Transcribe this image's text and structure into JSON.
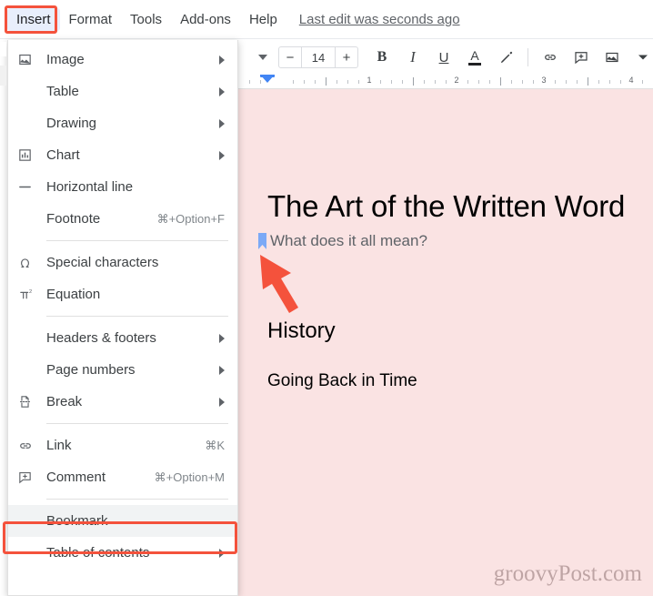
{
  "app": {
    "name": "Google Docs",
    "accent_blue": "#4285f4",
    "highlight_red": "#f4523c",
    "doc_background": "#fae3e3",
    "menu_hover": "#f1f3f4"
  },
  "menubar": {
    "items": [
      {
        "label": "Insert",
        "active": true
      },
      {
        "label": "Format",
        "active": false
      },
      {
        "label": "Tools",
        "active": false
      },
      {
        "label": "Add-ons",
        "active": false
      },
      {
        "label": "Help",
        "active": false
      }
    ],
    "last_edit": "Last edit was seconds ago"
  },
  "toolbar": {
    "font_dropdown_icon": "chevron-down-icon",
    "font_size_decrease": "−",
    "font_size_value": "14",
    "font_size_increase": "+",
    "bold": "B",
    "italic": "I",
    "underline": "U",
    "text_color": "A",
    "highlight_color_icon": "highlighter-icon",
    "link_icon": "link-icon",
    "comment_icon": "add-comment-icon",
    "image_icon": "insert-image-icon",
    "image_dropdown_icon": "chevron-down-icon",
    "align_icon": "align-left-icon"
  },
  "ruler": {
    "numbers": [
      "1",
      "2",
      "3",
      "4"
    ],
    "indent_marker": "left-indent-marker"
  },
  "insert_menu": {
    "items": [
      {
        "label": "Image",
        "icon": "image-icon",
        "submenu": true,
        "accel": "",
        "highlighted": false
      },
      {
        "label": "Table",
        "icon": "",
        "submenu": true,
        "accel": "",
        "highlighted": false
      },
      {
        "label": "Drawing",
        "icon": "",
        "submenu": true,
        "accel": "",
        "highlighted": false
      },
      {
        "label": "Chart",
        "icon": "chart-icon",
        "submenu": true,
        "accel": "",
        "highlighted": false
      },
      {
        "label": "Horizontal line",
        "icon": "horizontal-line-icon",
        "submenu": false,
        "accel": "",
        "highlighted": false
      },
      {
        "label": "Footnote",
        "icon": "",
        "submenu": false,
        "accel": "⌘+Option+F",
        "highlighted": false
      },
      {
        "separator": true
      },
      {
        "label": "Special characters",
        "icon": "omega-icon",
        "submenu": false,
        "accel": "",
        "highlighted": false
      },
      {
        "label": "Equation",
        "icon": "equation-icon",
        "submenu": false,
        "accel": "",
        "highlighted": false
      },
      {
        "separator": true
      },
      {
        "label": "Headers & footers",
        "icon": "",
        "submenu": true,
        "accel": "",
        "highlighted": false
      },
      {
        "label": "Page numbers",
        "icon": "",
        "submenu": true,
        "accel": "",
        "highlighted": false
      },
      {
        "label": "Break",
        "icon": "page-break-icon",
        "submenu": true,
        "accel": "",
        "highlighted": false
      },
      {
        "separator": true
      },
      {
        "label": "Link",
        "icon": "link-icon",
        "submenu": false,
        "accel": "⌘K",
        "highlighted": false
      },
      {
        "label": "Comment",
        "icon": "add-comment-icon",
        "submenu": false,
        "accel": "⌘+Option+M",
        "highlighted": false
      },
      {
        "separator": true
      },
      {
        "label": "Bookmark",
        "icon": "",
        "submenu": false,
        "accel": "",
        "highlighted": true
      },
      {
        "label": "Table of contents",
        "icon": "",
        "submenu": true,
        "accel": "",
        "highlighted": false
      }
    ]
  },
  "document": {
    "title": "The Art of the Written Word",
    "subtitle": "What does it all mean?",
    "bookmark_marker": "bookmark-ribbon-icon",
    "heading": "History",
    "paragraph": "Going Back in Time",
    "watermark": "groovyPost.com",
    "annotation_arrow": "red-arrow-pointing-to-bookmark"
  }
}
